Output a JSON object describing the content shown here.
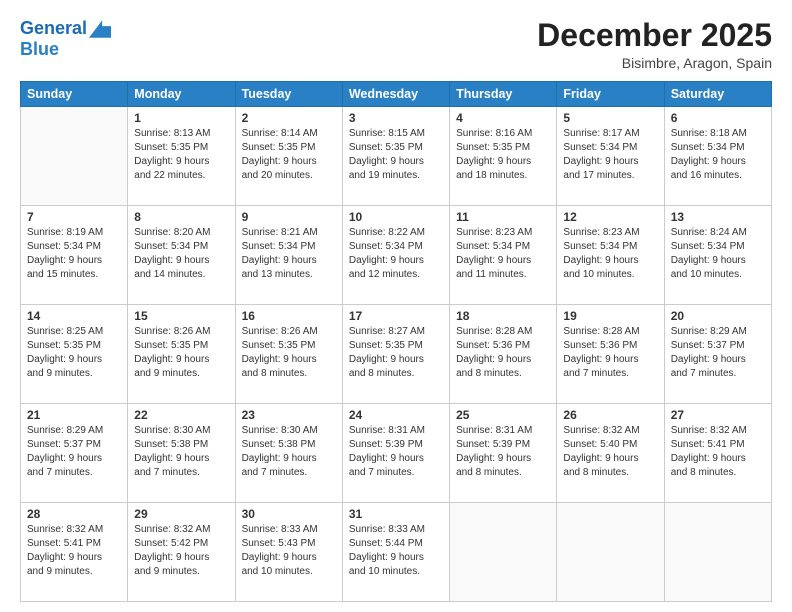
{
  "logo": {
    "line1": "General",
    "line2": "Blue"
  },
  "title": "December 2025",
  "subtitle": "Bisimbre, Aragon, Spain",
  "headers": [
    "Sunday",
    "Monday",
    "Tuesday",
    "Wednesday",
    "Thursday",
    "Friday",
    "Saturday"
  ],
  "weeks": [
    [
      {
        "day": "",
        "info": ""
      },
      {
        "day": "1",
        "info": "Sunrise: 8:13 AM\nSunset: 5:35 PM\nDaylight: 9 hours\nand 22 minutes."
      },
      {
        "day": "2",
        "info": "Sunrise: 8:14 AM\nSunset: 5:35 PM\nDaylight: 9 hours\nand 20 minutes."
      },
      {
        "day": "3",
        "info": "Sunrise: 8:15 AM\nSunset: 5:35 PM\nDaylight: 9 hours\nand 19 minutes."
      },
      {
        "day": "4",
        "info": "Sunrise: 8:16 AM\nSunset: 5:35 PM\nDaylight: 9 hours\nand 18 minutes."
      },
      {
        "day": "5",
        "info": "Sunrise: 8:17 AM\nSunset: 5:34 PM\nDaylight: 9 hours\nand 17 minutes."
      },
      {
        "day": "6",
        "info": "Sunrise: 8:18 AM\nSunset: 5:34 PM\nDaylight: 9 hours\nand 16 minutes."
      }
    ],
    [
      {
        "day": "7",
        "info": "Sunrise: 8:19 AM\nSunset: 5:34 PM\nDaylight: 9 hours\nand 15 minutes."
      },
      {
        "day": "8",
        "info": "Sunrise: 8:20 AM\nSunset: 5:34 PM\nDaylight: 9 hours\nand 14 minutes."
      },
      {
        "day": "9",
        "info": "Sunrise: 8:21 AM\nSunset: 5:34 PM\nDaylight: 9 hours\nand 13 minutes."
      },
      {
        "day": "10",
        "info": "Sunrise: 8:22 AM\nSunset: 5:34 PM\nDaylight: 9 hours\nand 12 minutes."
      },
      {
        "day": "11",
        "info": "Sunrise: 8:23 AM\nSunset: 5:34 PM\nDaylight: 9 hours\nand 11 minutes."
      },
      {
        "day": "12",
        "info": "Sunrise: 8:23 AM\nSunset: 5:34 PM\nDaylight: 9 hours\nand 10 minutes."
      },
      {
        "day": "13",
        "info": "Sunrise: 8:24 AM\nSunset: 5:34 PM\nDaylight: 9 hours\nand 10 minutes."
      }
    ],
    [
      {
        "day": "14",
        "info": "Sunrise: 8:25 AM\nSunset: 5:35 PM\nDaylight: 9 hours\nand 9 minutes."
      },
      {
        "day": "15",
        "info": "Sunrise: 8:26 AM\nSunset: 5:35 PM\nDaylight: 9 hours\nand 9 minutes."
      },
      {
        "day": "16",
        "info": "Sunrise: 8:26 AM\nSunset: 5:35 PM\nDaylight: 9 hours\nand 8 minutes."
      },
      {
        "day": "17",
        "info": "Sunrise: 8:27 AM\nSunset: 5:35 PM\nDaylight: 9 hours\nand 8 minutes."
      },
      {
        "day": "18",
        "info": "Sunrise: 8:28 AM\nSunset: 5:36 PM\nDaylight: 9 hours\nand 8 minutes."
      },
      {
        "day": "19",
        "info": "Sunrise: 8:28 AM\nSunset: 5:36 PM\nDaylight: 9 hours\nand 7 minutes."
      },
      {
        "day": "20",
        "info": "Sunrise: 8:29 AM\nSunset: 5:37 PM\nDaylight: 9 hours\nand 7 minutes."
      }
    ],
    [
      {
        "day": "21",
        "info": "Sunrise: 8:29 AM\nSunset: 5:37 PM\nDaylight: 9 hours\nand 7 minutes."
      },
      {
        "day": "22",
        "info": "Sunrise: 8:30 AM\nSunset: 5:38 PM\nDaylight: 9 hours\nand 7 minutes."
      },
      {
        "day": "23",
        "info": "Sunrise: 8:30 AM\nSunset: 5:38 PM\nDaylight: 9 hours\nand 7 minutes."
      },
      {
        "day": "24",
        "info": "Sunrise: 8:31 AM\nSunset: 5:39 PM\nDaylight: 9 hours\nand 7 minutes."
      },
      {
        "day": "25",
        "info": "Sunrise: 8:31 AM\nSunset: 5:39 PM\nDaylight: 9 hours\nand 8 minutes."
      },
      {
        "day": "26",
        "info": "Sunrise: 8:32 AM\nSunset: 5:40 PM\nDaylight: 9 hours\nand 8 minutes."
      },
      {
        "day": "27",
        "info": "Sunrise: 8:32 AM\nSunset: 5:41 PM\nDaylight: 9 hours\nand 8 minutes."
      }
    ],
    [
      {
        "day": "28",
        "info": "Sunrise: 8:32 AM\nSunset: 5:41 PM\nDaylight: 9 hours\nand 9 minutes."
      },
      {
        "day": "29",
        "info": "Sunrise: 8:32 AM\nSunset: 5:42 PM\nDaylight: 9 hours\nand 9 minutes."
      },
      {
        "day": "30",
        "info": "Sunrise: 8:33 AM\nSunset: 5:43 PM\nDaylight: 9 hours\nand 10 minutes."
      },
      {
        "day": "31",
        "info": "Sunrise: 8:33 AM\nSunset: 5:44 PM\nDaylight: 9 hours\nand 10 minutes."
      },
      {
        "day": "",
        "info": ""
      },
      {
        "day": "",
        "info": ""
      },
      {
        "day": "",
        "info": ""
      }
    ]
  ]
}
